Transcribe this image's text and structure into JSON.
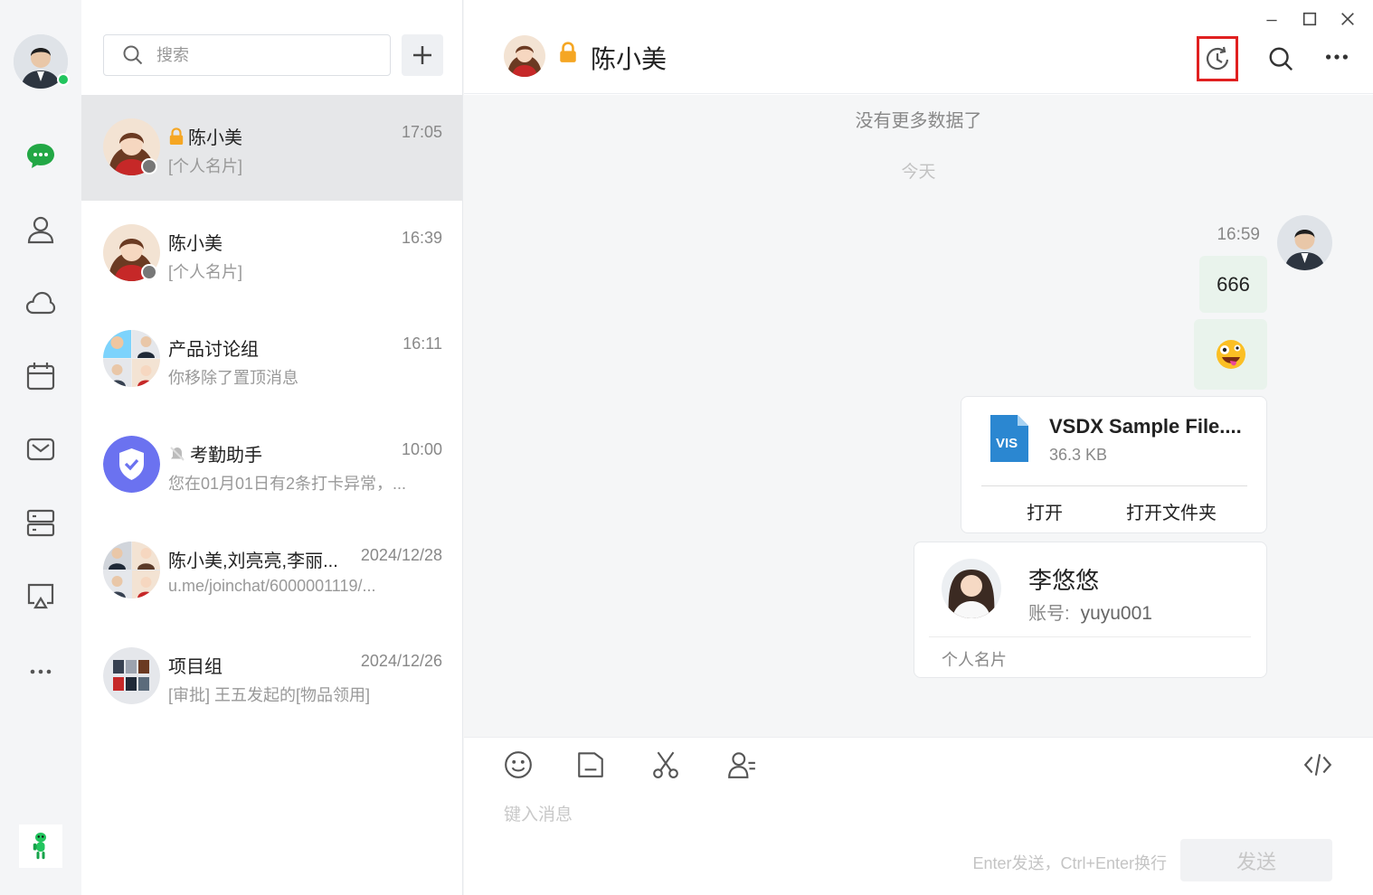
{
  "rail": {
    "user_name": "me",
    "nav": [
      {
        "icon": "chat-bubble-icon",
        "active": true
      },
      {
        "icon": "contacts-icon"
      },
      {
        "icon": "cloud-icon"
      },
      {
        "icon": "calendar-icon"
      },
      {
        "icon": "mail-icon"
      },
      {
        "icon": "server-icon"
      },
      {
        "icon": "screen-share-icon"
      },
      {
        "icon": "more-icon"
      }
    ],
    "accent": "#22a745"
  },
  "list": {
    "search_placeholder": "搜索",
    "conversations": [
      {
        "name": "陈小美",
        "time": "17:05",
        "preview": "[个人名片]",
        "locked": true
      },
      {
        "name": "陈小美",
        "time": "16:39",
        "preview": "[个人名片]"
      },
      {
        "name": "产品讨论组",
        "time": "16:11",
        "preview": "你移除了置顶消息"
      },
      {
        "name": "考勤助手",
        "time": "10:00",
        "preview": "您在01月01日有2条打卡异常，..."
      },
      {
        "name": "陈小美,刘亮亮,李丽...",
        "time": "2024/12/28",
        "preview": "u.me/joinchat/6000001119/..."
      },
      {
        "name": "项目组",
        "time": "2024/12/26",
        "preview": "[审批] 王五发起的[物品领用]"
      }
    ]
  },
  "chat": {
    "title": "陈小美",
    "system_no_more": "没有更多数据了",
    "date_divider": "今天",
    "message_time": "16:59",
    "text_message": "666",
    "file": {
      "name": "VSDX Sample File....",
      "size": "36.3 KB",
      "icon_label": "VIS",
      "open_label": "打开",
      "open_folder_label": "打开文件夹"
    },
    "contact_card": {
      "name": "李悠悠",
      "account_label": "账号:",
      "account_value": "yuyu001",
      "type_label": "个人名片"
    },
    "composer": {
      "placeholder": "键入消息",
      "hint": "Enter发送，Ctrl+Enter换行",
      "send_label": "发送"
    }
  }
}
